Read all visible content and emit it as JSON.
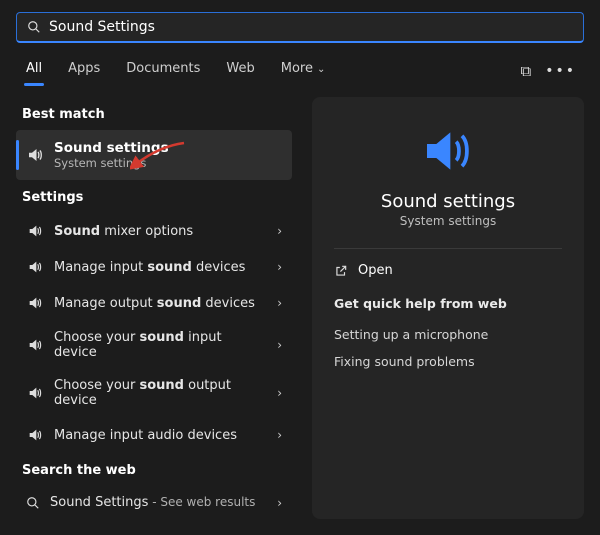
{
  "search": {
    "value": "Sound Settings"
  },
  "tabs": {
    "all": "All",
    "apps": "Apps",
    "documents": "Documents",
    "web": "Web",
    "more": "More"
  },
  "sections": {
    "best_match": "Best match",
    "settings": "Settings",
    "search_web": "Search the web"
  },
  "best_match": {
    "title": "Sound settings",
    "subtitle": "System settings"
  },
  "settings_items": [
    {
      "pre": "",
      "bold": "Sound",
      "post": " mixer options"
    },
    {
      "pre": "Manage input ",
      "bold": "sound",
      "post": " devices"
    },
    {
      "pre": "Manage output ",
      "bold": "sound",
      "post": " devices"
    },
    {
      "pre": "Choose your ",
      "bold": "sound",
      "post": " input device"
    },
    {
      "pre": "Choose your ",
      "bold": "sound",
      "post": " output device"
    },
    {
      "pre": "Manage input audio devices",
      "bold": "",
      "post": ""
    }
  ],
  "web_item": {
    "title": "Sound Settings",
    "suffix": " - See web results"
  },
  "detail": {
    "title": "Sound settings",
    "subtitle": "System settings",
    "open": "Open",
    "help_header": "Get quick help from web",
    "help_links": [
      "Setting up a microphone",
      "Fixing sound problems"
    ]
  },
  "colors": {
    "accent": "#3a86ff",
    "arrow": "#d33a2f"
  }
}
